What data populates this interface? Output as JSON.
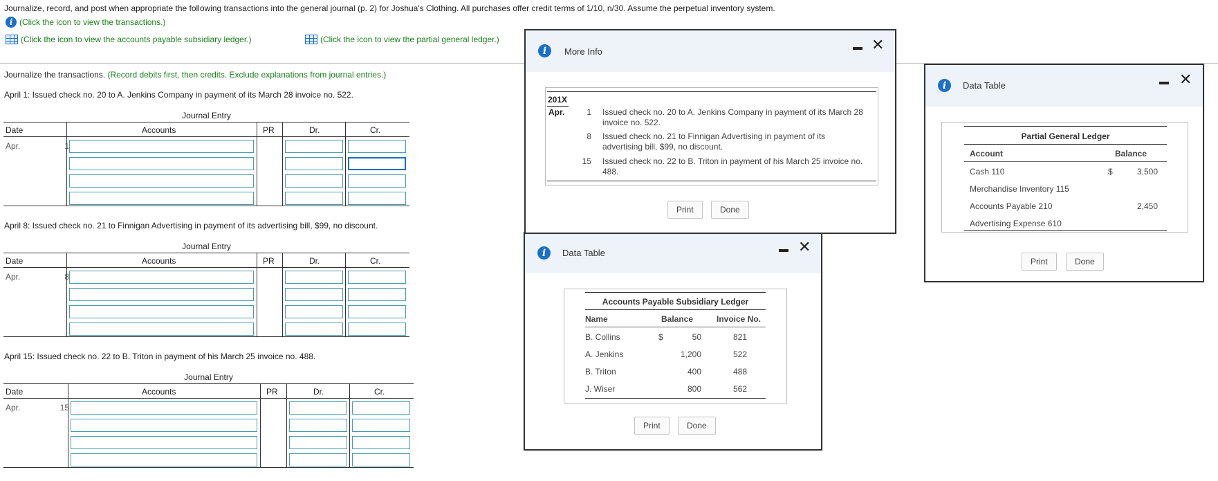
{
  "instructions": {
    "main": "Journalize, record, and post when appropriate the following transactions into the general journal (p. 2) for Joshua's Clothing. All purchases offer credit terms of 1/10, n/30. Assume the perpetual inventory system.",
    "link_transactions": "(Click the icon to view the transactions.)",
    "link_ap_ledger": "(Click the icon to view the accounts payable subsidiary ledger.)",
    "link_gl": "(Click the icon to view the partial general ledger.)",
    "journalize": "Journalize the transactions.",
    "journalize_note": "(Record debits first, then credits. Exclude explanations from journal entries.)"
  },
  "journal_headers": {
    "title": "Journal Entry",
    "date": "Date",
    "accounts": "Accounts",
    "pr": "PR",
    "dr": "Dr.",
    "cr": "Cr."
  },
  "entries": [
    {
      "prompt": "April 1: Issued check no. 20 to A. Jenkins Company in payment of its March 28 invoice no. 522.",
      "month": "Apr.",
      "day": "1"
    },
    {
      "prompt": "April 8: Issued check no. 21 to Finnigan Advertising in payment of its advertising bill, $99, no discount.",
      "month": "Apr.",
      "day": "8"
    },
    {
      "prompt": "April 15: Issued check no. 22 to B. Triton in payment of his March 25 invoice no. 488.",
      "month": "Apr.",
      "day": "15"
    }
  ],
  "more_info": {
    "title": "More Info",
    "year": "201X",
    "month": "Apr.",
    "rows": [
      {
        "day": "1",
        "text": "Issued check no. 20 to A. Jenkins Company in payment of its March 28 invoice no. 522."
      },
      {
        "day": "8",
        "text": "Issued check no. 21 to Finnigan Advertising in payment of its advertising bill, $99, no discount."
      },
      {
        "day": "15",
        "text": "Issued check no. 22 to B. Triton in payment of his March 25 invoice no. 488."
      }
    ],
    "print": "Print",
    "done": "Done"
  },
  "ap_ledger": {
    "title": "Data Table",
    "table_title": "Accounts Payable Subsidiary Ledger",
    "headers": {
      "name": "Name",
      "balance": "Balance",
      "invoice": "Invoice No."
    },
    "currency": "$",
    "rows": [
      {
        "name": "B. Collins",
        "balance": "50",
        "invoice": "821"
      },
      {
        "name": "A. Jenkins",
        "balance": "1,200",
        "invoice": "522"
      },
      {
        "name": "B. Triton",
        "balance": "400",
        "invoice": "488"
      },
      {
        "name": "J. Wiser",
        "balance": "800",
        "invoice": "562"
      }
    ],
    "print": "Print",
    "done": "Done"
  },
  "gl": {
    "title": "Data Table",
    "table_title": "Partial General Ledger",
    "headers": {
      "account": "Account",
      "balance": "Balance"
    },
    "currency": "$",
    "rows": [
      {
        "account": "Cash 110",
        "balance": "3,500"
      },
      {
        "account": "Merchandise Inventory 115",
        "balance": ""
      },
      {
        "account": "Accounts Payable 210",
        "balance": "2,450"
      },
      {
        "account": "Advertising Expense 610",
        "balance": ""
      }
    ],
    "print": "Print",
    "done": "Done"
  }
}
